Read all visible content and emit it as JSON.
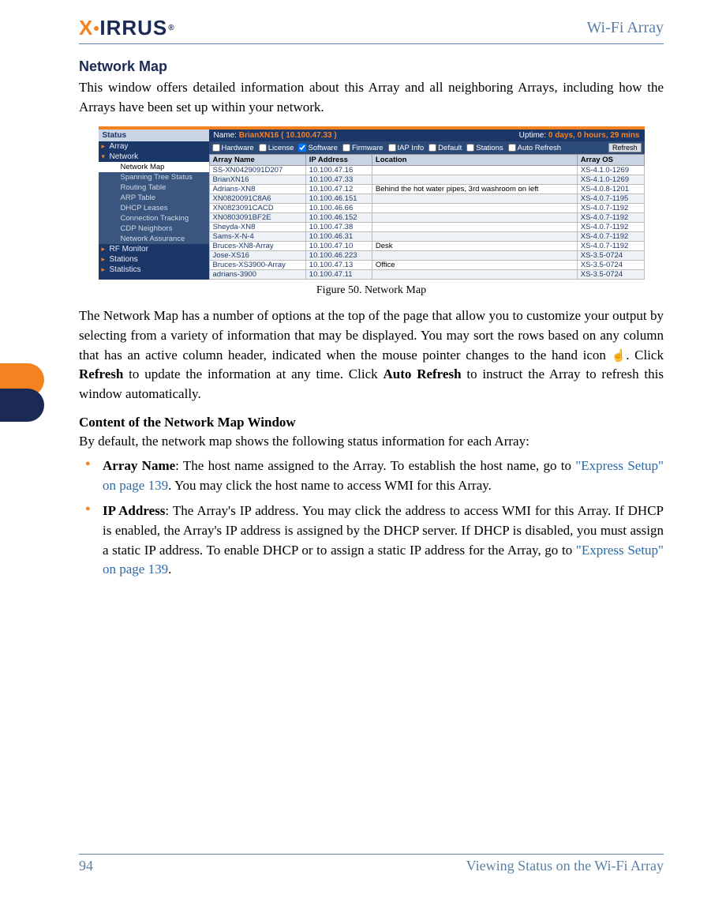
{
  "header": {
    "logo_text_1": "X",
    "logo_text_2": "IRRUS",
    "product": "Wi-Fi Array"
  },
  "section_title": "Network Map",
  "intro": "This window offers detailed information about this Array and all neighboring Arrays, including how the Arrays have been set up within your network.",
  "figure_caption": "Figure 50. Network Map",
  "para2_a": "The Network Map has a number of options at the top of the page that allow you to customize your output by selecting from a variety of information that may be displayed. You may sort the rows based on any column that has an active column header, indicated when the mouse pointer changes to the hand icon ",
  "para2_b": ". Click ",
  "para2_refresh": "Refresh",
  "para2_c": " to update the information at any time. Click ",
  "para2_auto": "Auto Refresh",
  "para2_d": " to instruct the Array to refresh this window automatically.",
  "subheading": "Content of the Network Map Window",
  "para3": "By default, the network map shows the following status information for each Array:",
  "bullets": {
    "b1_label": "Array Name",
    "b1_text_a": ": The host name assigned to the Array. To establish the host name, go to ",
    "b1_link": "\"Express Setup\" on page 139",
    "b1_text_b": ". You may click the host name to access WMI for this Array.",
    "b2_label": "IP Address",
    "b2_text_a": ": The Array's IP address. You may click the address to access WMI for this Array. If DHCP is enabled, the Array's IP address is assigned by the DHCP server. If DHCP is disabled, you must assign a static IP address. To enable DHCP or to assign a static IP address for the Array, go to ",
    "b2_link": "\"Express Setup\" on page 139",
    "b2_text_b": "."
  },
  "footer": {
    "page": "94",
    "title": "Viewing Status on the Wi-Fi Array"
  },
  "screenshot": {
    "sidebar": {
      "header": "Status",
      "items": [
        "Array",
        "Network"
      ],
      "subs": [
        "Network Map",
        "Spanning Tree Status",
        "Routing Table",
        "ARP Table",
        "DHCP Leases",
        "Connection Tracking",
        "CDP Neighbors",
        "Network Assurance"
      ],
      "tail": [
        "RF Monitor",
        "Stations",
        "Statistics"
      ]
    },
    "titlebar": {
      "name_label": "Name:",
      "name_value": "BrianXN16   ( 10.100.47.33 )",
      "uptime_label": "Uptime:",
      "uptime_value": "0 days, 0 hours, 29 mins"
    },
    "filters": [
      "Hardware",
      "License",
      "Software",
      "Firmware",
      "IAP Info",
      "Default",
      "Stations",
      "Auto Refresh"
    ],
    "filters_checked": [
      false,
      false,
      true,
      false,
      false,
      false,
      false,
      false
    ],
    "refresh_btn": "Refresh",
    "columns": [
      "Array Name",
      "IP Address",
      "Location",
      "Array OS"
    ],
    "rows": [
      {
        "name": "SS-XN0429091D207",
        "ip": "10.100.47.16",
        "loc": "",
        "os": "XS-4.1.0-1269"
      },
      {
        "name": "BrianXN16",
        "ip": "10.100.47.33",
        "loc": "",
        "os": "XS-4.1.0-1269"
      },
      {
        "name": "Adrians-XN8",
        "ip": "10.100.47.12",
        "loc": "Behind the hot water pipes, 3rd washroom on left",
        "os": "XS-4.0.8-1201"
      },
      {
        "name": "XN0820091C8A6",
        "ip": "10.100.46.151",
        "loc": "",
        "os": "XS-4.0.7-1195"
      },
      {
        "name": "XN0823091CACD",
        "ip": "10.100.46.66",
        "loc": "",
        "os": "XS-4.0.7-1192"
      },
      {
        "name": "XN0803091BF2E",
        "ip": "10.100.46.152",
        "loc": "",
        "os": "XS-4.0.7-1192"
      },
      {
        "name": "Sheyda-XN8",
        "ip": "10.100.47.38",
        "loc": "",
        "os": "XS-4.0.7-1192"
      },
      {
        "name": "Sams-X-N-4",
        "ip": "10.100.46.31",
        "loc": "",
        "os": "XS-4.0.7-1192"
      },
      {
        "name": "Bruces-XN8-Array",
        "ip": "10.100.47.10",
        "loc": "Desk",
        "os": "XS-4.0.7-1192"
      },
      {
        "name": "Jose-XS16",
        "ip": "10.100.46.223",
        "loc": "",
        "os": "XS-3.5-0724"
      },
      {
        "name": "Bruces-XS3900-Array",
        "ip": "10.100.47.13",
        "loc": "Office",
        "os": "XS-3.5-0724"
      },
      {
        "name": "adrians-3900",
        "ip": "10.100.47.11",
        "loc": "",
        "os": "XS-3.5-0724"
      }
    ]
  }
}
